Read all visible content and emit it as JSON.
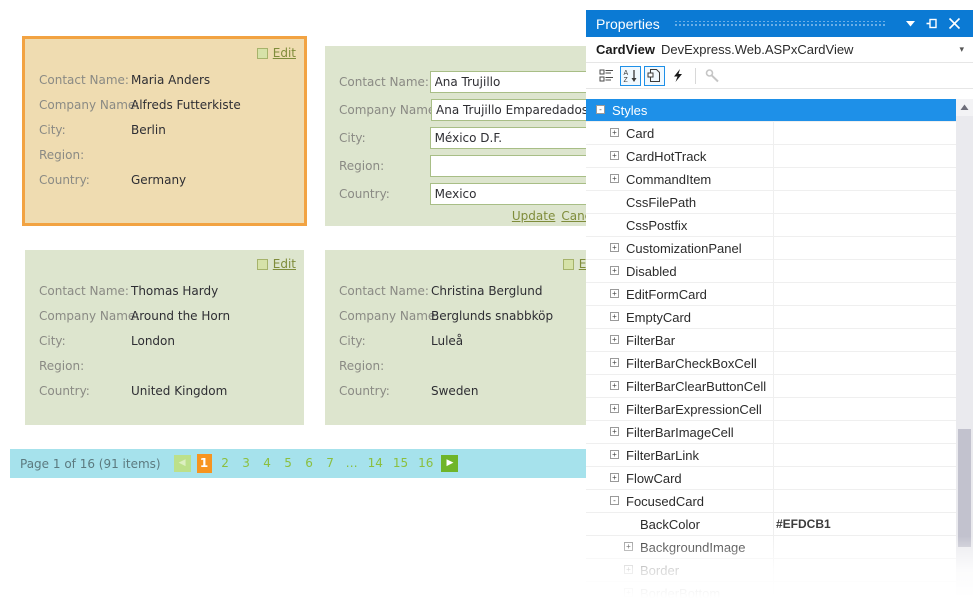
{
  "cardview": {
    "cards": [
      {
        "state": "focused",
        "edit_label": "Edit",
        "fields": [
          {
            "label": "Contact Name:",
            "value": "Maria Anders"
          },
          {
            "label": "Company Name:",
            "value": "Alfreds Futterkiste"
          },
          {
            "label": "City:",
            "value": "Berlin"
          },
          {
            "label": "Region:",
            "value": ""
          },
          {
            "label": "Country:",
            "value": "Germany"
          }
        ]
      },
      {
        "state": "editing",
        "update_label": "Update",
        "cancel_label": "Cancel",
        "fields": [
          {
            "label": "Contact Name:",
            "value": "Ana Trujillo"
          },
          {
            "label": "Company Name:",
            "value": "Ana Trujillo Emparedados y"
          },
          {
            "label": "City:",
            "value": "México D.F."
          },
          {
            "label": "Region:",
            "value": ""
          },
          {
            "label": "Country:",
            "value": "Mexico"
          }
        ]
      },
      {
        "state": "normal",
        "edit_label": "Edit",
        "fields": [
          {
            "label": "Contact Name:",
            "value": "Thomas Hardy"
          },
          {
            "label": "Company Name:",
            "value": "Around the Horn"
          },
          {
            "label": "City:",
            "value": "London"
          },
          {
            "label": "Region:",
            "value": ""
          },
          {
            "label": "Country:",
            "value": "United Kingdom"
          }
        ]
      },
      {
        "state": "normal",
        "edit_label": "Edit",
        "fields": [
          {
            "label": "Contact Name:",
            "value": "Christina Berglund"
          },
          {
            "label": "Company Name:",
            "value": "Berglunds snabbköp"
          },
          {
            "label": "City:",
            "value": "Luleå"
          },
          {
            "label": "Region:",
            "value": ""
          },
          {
            "label": "Country:",
            "value": "Sweden"
          }
        ]
      }
    ],
    "pager": {
      "summary": "Page 1 of 16 (91 items)",
      "prev_label": "◀",
      "next_label": "▶",
      "pages": [
        "1",
        "2",
        "3",
        "4",
        "5",
        "6",
        "7",
        "…",
        "14",
        "15",
        "16"
      ],
      "current": "1",
      "current_color": "#F79420",
      "bar_color": "#A6E2EC"
    }
  },
  "properties": {
    "title": "Properties",
    "titlebar_color": "#0B7AD4",
    "object_name": "CardView",
    "object_type": "DevExpress.Web.ASPxCardView",
    "toolbar": {
      "categorized": "categorized-icon",
      "alphabetical": "alphabetical-sort-icon",
      "properties_page": "properties-page-icon",
      "events": "events-lightning-icon",
      "property_pages": "wrench-icon"
    },
    "selected_row": "Styles",
    "rows": [
      {
        "name": "Styles",
        "depth": 0,
        "expander": "-",
        "value": "",
        "selected": true
      },
      {
        "name": "Card",
        "depth": 1,
        "expander": "+",
        "value": ""
      },
      {
        "name": "CardHotTrack",
        "depth": 1,
        "expander": "+",
        "value": ""
      },
      {
        "name": "CommandItem",
        "depth": 1,
        "expander": "+",
        "value": ""
      },
      {
        "name": "CssFilePath",
        "depth": 1,
        "expander": "",
        "value": ""
      },
      {
        "name": "CssPostfix",
        "depth": 1,
        "expander": "",
        "value": ""
      },
      {
        "name": "CustomizationPanel",
        "depth": 1,
        "expander": "+",
        "value": ""
      },
      {
        "name": "Disabled",
        "depth": 1,
        "expander": "+",
        "value": ""
      },
      {
        "name": "EditFormCard",
        "depth": 1,
        "expander": "+",
        "value": ""
      },
      {
        "name": "EmptyCard",
        "depth": 1,
        "expander": "+",
        "value": ""
      },
      {
        "name": "FilterBar",
        "depth": 1,
        "expander": "+",
        "value": ""
      },
      {
        "name": "FilterBarCheckBoxCell",
        "depth": 1,
        "expander": "+",
        "value": ""
      },
      {
        "name": "FilterBarClearButtonCell",
        "depth": 1,
        "expander": "+",
        "value": ""
      },
      {
        "name": "FilterBarExpressionCell",
        "depth": 1,
        "expander": "+",
        "value": ""
      },
      {
        "name": "FilterBarImageCell",
        "depth": 1,
        "expander": "+",
        "value": ""
      },
      {
        "name": "FilterBarLink",
        "depth": 1,
        "expander": "+",
        "value": ""
      },
      {
        "name": "FlowCard",
        "depth": 1,
        "expander": "+",
        "value": ""
      },
      {
        "name": "FocusedCard",
        "depth": 1,
        "expander": "-",
        "value": ""
      },
      {
        "name": "BackColor",
        "depth": 2,
        "expander": "",
        "value": "#EFDCB1"
      },
      {
        "name": "BackgroundImage",
        "depth": 2,
        "expander": "+",
        "value": ""
      },
      {
        "name": "Border",
        "depth": 2,
        "expander": "+",
        "value": ""
      },
      {
        "name": "BorderBottom",
        "depth": 2,
        "expander": "+",
        "value": ""
      }
    ]
  }
}
